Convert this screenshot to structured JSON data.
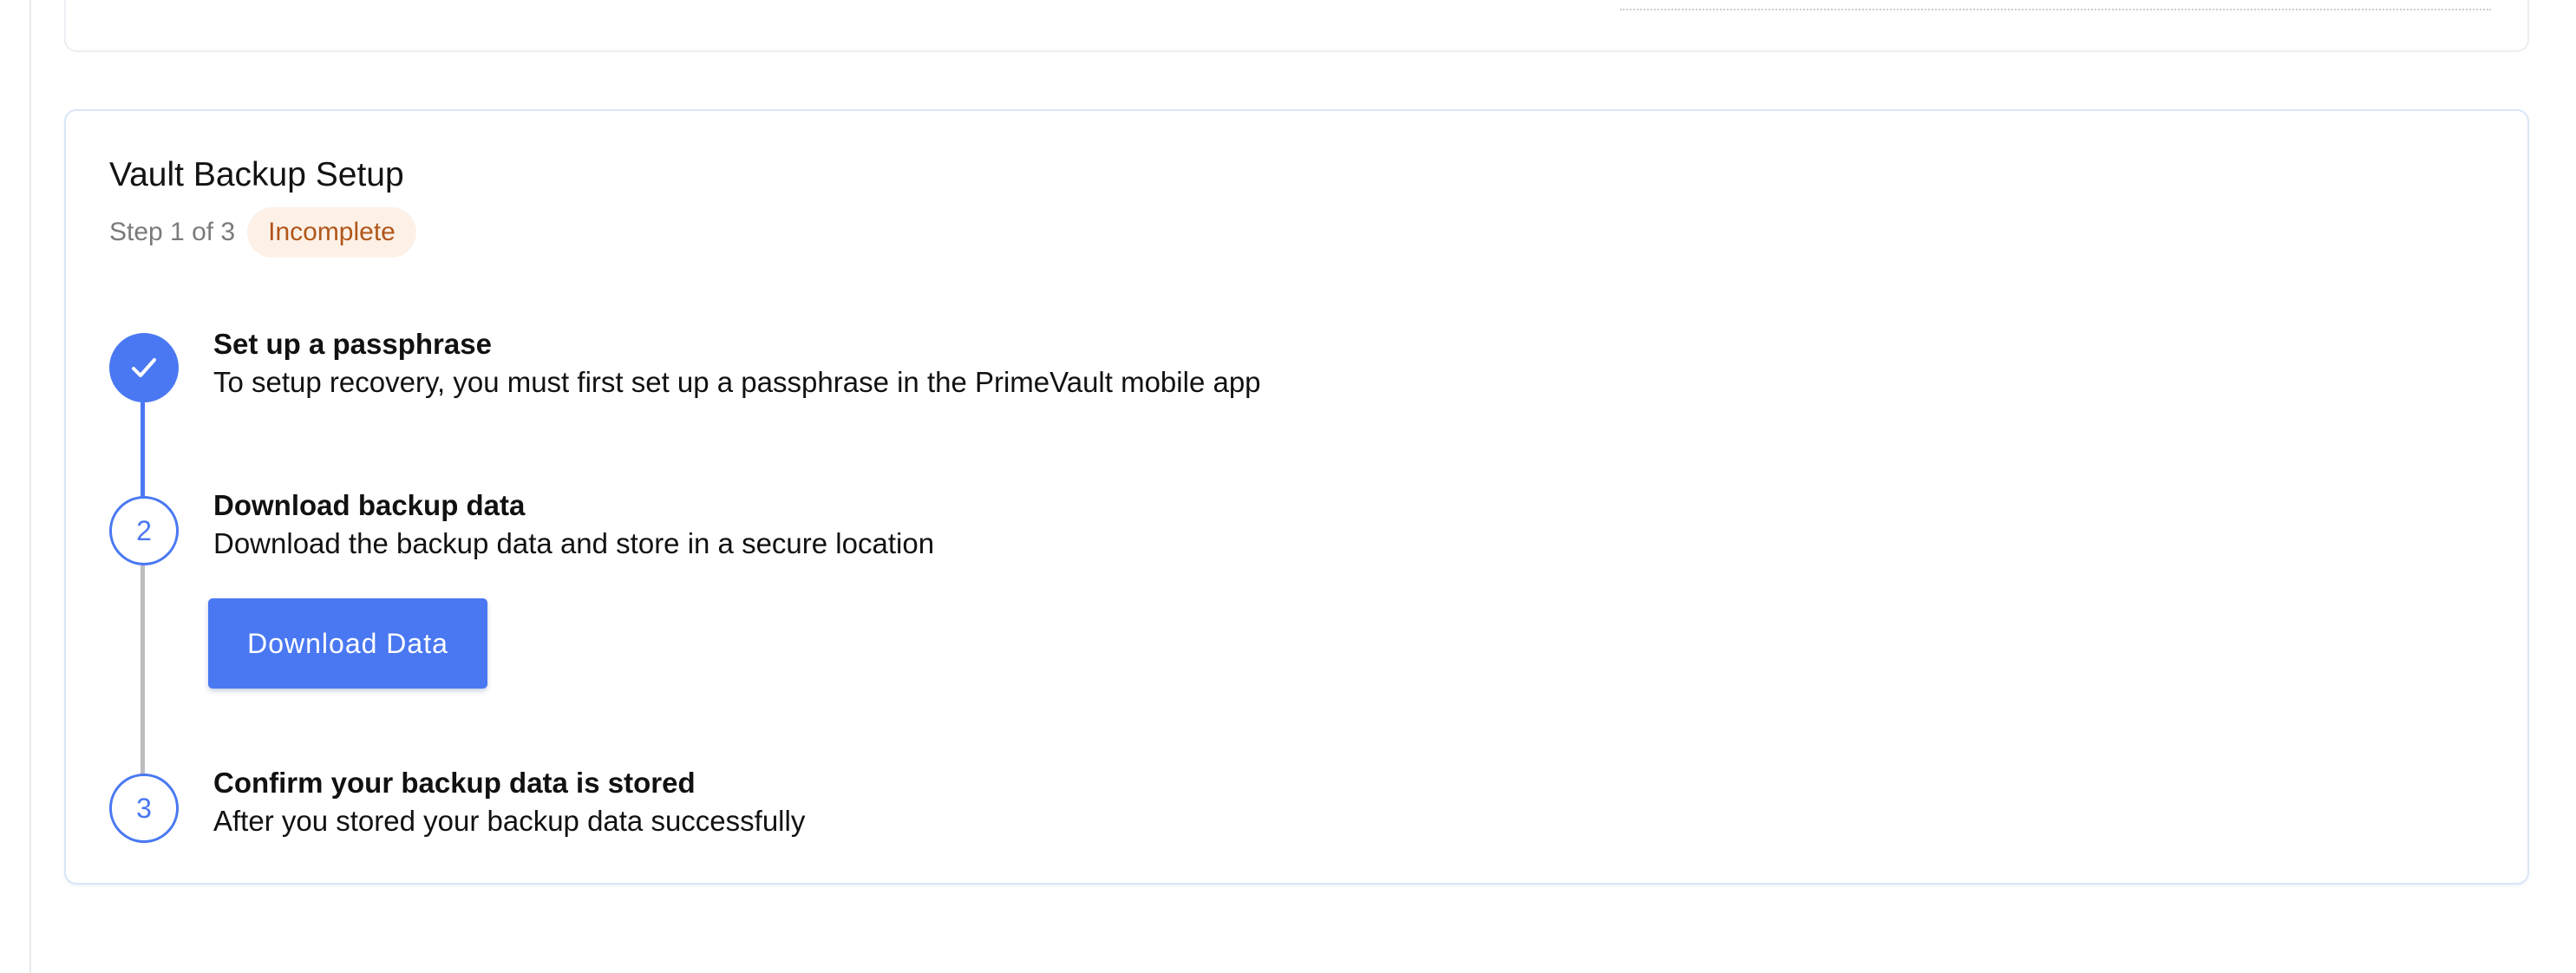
{
  "backup": {
    "title": "Vault Backup Setup",
    "progress_text": "Step 1 of 3",
    "status_badge": "Incomplete",
    "steps": [
      {
        "marker": "",
        "state": "complete",
        "title": "Set up a passphrase",
        "description": "To setup recovery, you must first set up a passphrase in the PrimeVault mobile app"
      },
      {
        "marker": "2",
        "state": "current",
        "title": "Download backup data",
        "description": "Download the backup data and store in a secure location",
        "button_label": "Download Data"
      },
      {
        "marker": "3",
        "state": "pending",
        "title": "Confirm your backup data is stored",
        "description": "After you stored your backup data successfully"
      }
    ]
  },
  "colors": {
    "accent": "#4a78f2",
    "badge_background": "#fdf1e7",
    "badge_text": "#b1561a",
    "pending_connector": "#bdbdbd"
  },
  "icons": {
    "step_complete": "checkmark-icon"
  }
}
